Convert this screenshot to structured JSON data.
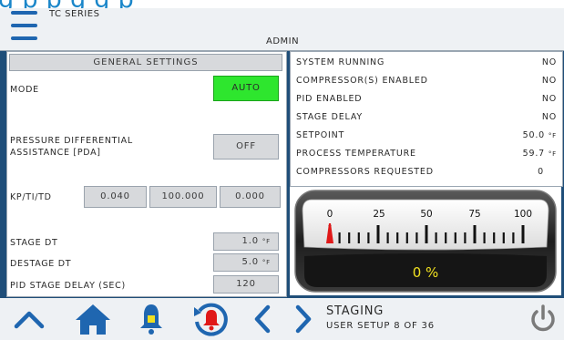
{
  "cutoff_text": "g                                  p              p        g g        p",
  "header": {
    "series": "TC SERIES",
    "user": "ADMIN"
  },
  "general": {
    "title": "GENERAL SETTINGS",
    "mode_label": "MODE",
    "mode_value": "AUTO",
    "pda_label_line1": "PRESSURE DIFFERENTIAL",
    "pda_label_line2": "ASSISTANCE [PDA]",
    "pda_value": "OFF",
    "kp_label": "KP/TI/TD",
    "kp": "0.040",
    "ti": "100.000",
    "td": "0.000",
    "stage_dt_label": "STAGE DT",
    "stage_dt_value": "1.0",
    "destage_dt_label": "DESTAGE DT",
    "destage_dt_value": "5.0",
    "temp_unit": "°F",
    "pid_delay_label": "PID STAGE DELAY (SEC)",
    "pid_delay_value": "120"
  },
  "status": [
    {
      "label": "SYSTEM RUNNING",
      "value": "NO"
    },
    {
      "label": "COMPRESSOR(S) ENABLED",
      "value": "NO"
    },
    {
      "label": "PID ENABLED",
      "value": "NO"
    },
    {
      "label": "STAGE DELAY",
      "value": "NO"
    },
    {
      "label": "SETPOINT",
      "value": "50.0",
      "unit": "°F"
    },
    {
      "label": "PROCESS TEMPERATURE",
      "value": "59.7",
      "unit": "°F"
    },
    {
      "label": "COMPRESSORS REQUESTED",
      "value": "0"
    }
  ],
  "gauge": {
    "ticks": [
      "0",
      "25",
      "50",
      "75",
      "100"
    ],
    "percent": 0,
    "readout": "0 %"
  },
  "footer": {
    "title": "STAGING",
    "subtitle": "USER SETUP 8 OF 36",
    "icons": [
      "up-chevron-icon",
      "home-icon",
      "bell-icon",
      "alarm-reset-icon",
      "left-chevron-icon",
      "right-chevron-icon",
      "power-icon"
    ]
  },
  "colors": {
    "accent": "#1f66b0",
    "active_green": "#2ee62e",
    "gauge_readout": "#f0e020"
  }
}
